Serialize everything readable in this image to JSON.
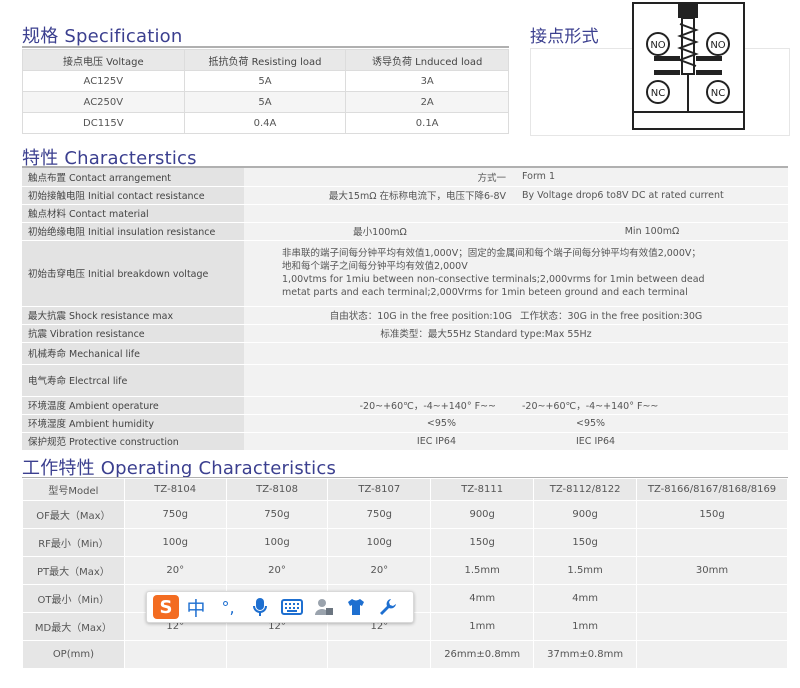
{
  "spec": {
    "title_cn": "规格",
    "title_en": "Specification",
    "headers": [
      "接点电压 Voltage",
      "抵抗负荷 Resisting load",
      "诱导负荷 Lnduced load"
    ],
    "rows": [
      [
        "AC125V",
        "5A",
        "3A"
      ],
      [
        "AC250V",
        "5A",
        "2A"
      ],
      [
        "DC115V",
        "0.4A",
        "0.1A"
      ]
    ]
  },
  "contact": {
    "title": "接点形式",
    "labels": [
      "NO",
      "NO",
      "NC",
      "NC"
    ]
  },
  "chars": {
    "title_cn": "特性",
    "title_en": "Characterstics",
    "rows": [
      {
        "label": "触点布置 Contact arrangement",
        "a": "方式一",
        "b": "Form 1"
      },
      {
        "label": "初始接触电阻 Initial contact resistance",
        "a": "最大15mΩ 在标称电流下，电压下降6-8V",
        "b": "By Voltage drop6 to8V DC at rated current"
      },
      {
        "label": "触点材料 Contact material",
        "a": "",
        "b": ""
      },
      {
        "label": "初始绝缘电阻 Initial insulation resistance",
        "a": "最小100mΩ",
        "b": "Min 100mΩ"
      },
      {
        "label": "初始击穿电压 Initial breakdown voltage",
        "lines": [
          "非串联的端子间每分钟平均有效值1,000V；固定的金属间和每个端子间每分钟平均有效值2,000V；",
          "地和每个端子之间每分钟平均有效值2,000V",
          "1,00vtms for 1miu between non-consective terminals;2,000vrms for 1min between dead",
          "metat parts and each terminal;2,000Vrms for 1min beteen ground and each terminal"
        ]
      },
      {
        "label": "最大抗震 Shock resistance max",
        "a": "自由状态：10G   in the free position:10G",
        "b": "工作状态：30G   in the free position:30G"
      },
      {
        "label": "抗震 Vibration resistance",
        "a": "标准类型：最大55Hz Standard type:Max 55Hz",
        "b": ""
      },
      {
        "label": "机械寿命 Mechanical life",
        "a": "",
        "b": ""
      },
      {
        "label": "电气寿命 Electrcal life",
        "a": "",
        "b": ""
      },
      {
        "label": "环境温度 Ambient operature",
        "a": "-20~+60℃，-4~+140° F~~",
        "b": "-20~+60℃，-4~+140° F~~"
      },
      {
        "label": "环境湿度 Ambient humidity",
        "a": "<95%",
        "b": "<95%"
      },
      {
        "label": "保护规范 Protective construction",
        "a": "IEC IP64",
        "b": "IEC IP64"
      }
    ]
  },
  "oper": {
    "title_cn": "工作特性",
    "title_en": "Operating Characteristics",
    "headers": [
      "型号Model",
      "TZ-8104",
      "TZ-8108",
      "TZ-8107",
      "TZ-8111",
      "TZ-8112/8122",
      "TZ-8166/8167/8168/8169"
    ],
    "rows": [
      [
        "OF最大（Max）",
        "750g",
        "750g",
        "750g",
        "900g",
        "900g",
        "150g"
      ],
      [
        "RF最小（Min）",
        "100g",
        "100g",
        "100g",
        "150g",
        "150g",
        ""
      ],
      [
        "PT最大（Max）",
        "20°",
        "20°",
        "20°",
        "1.5mm",
        "1.5mm",
        "30mm"
      ],
      [
        "OT最小（Min）",
        "",
        "",
        "",
        "4mm",
        "4mm",
        ""
      ],
      [
        "MD最大（Max）",
        "12°",
        "12°",
        "12°",
        "1mm",
        "1mm",
        ""
      ],
      [
        "OP(mm)",
        "",
        "",
        "",
        "26mm±0.8mm",
        "37mm±0.8mm",
        ""
      ]
    ]
  },
  "toolbar": {
    "logo": "S",
    "zhong": "中",
    "punct": "°,"
  }
}
